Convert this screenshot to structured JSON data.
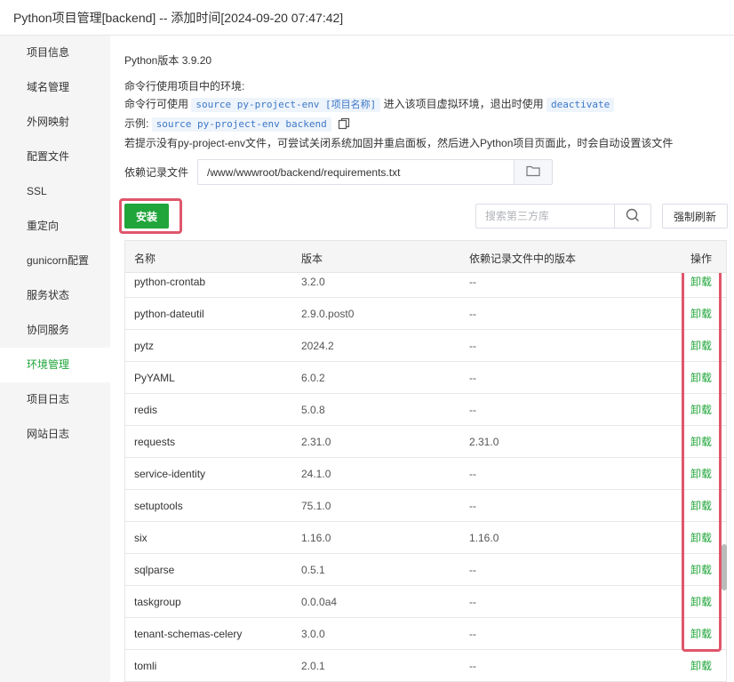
{
  "window": {
    "title": "Python项目管理[backend] -- 添加时间[2024-09-20 07:47:42]"
  },
  "sidebar": {
    "items": [
      {
        "label": "项目信息"
      },
      {
        "label": "域名管理"
      },
      {
        "label": "外网映射"
      },
      {
        "label": "配置文件"
      },
      {
        "label": "SSL"
      },
      {
        "label": "重定向"
      },
      {
        "label": "gunicorn配置"
      },
      {
        "label": "服务状态"
      },
      {
        "label": "协同服务"
      },
      {
        "label": "环境管理"
      },
      {
        "label": "项目日志"
      },
      {
        "label": "网站日志"
      }
    ],
    "active_index": 9
  },
  "env_info": {
    "python_version": "Python版本 3.9.20",
    "cmd_heading": "命令行使用项目中的环境:",
    "cmd_prefix": "命令行可使用",
    "cmd_code": "source py-project-env [项目名称]",
    "cmd_middle": "进入该项目虚拟环境，退出时使用",
    "cmd_deactivate": "deactivate",
    "example_label": "示例:",
    "example_code": "source py-project-env backend",
    "hint": "若提示没有py-project-env文件，可尝试关闭系统加固并重启面板，然后进入Python项目页面此，时会自动设置该文件"
  },
  "requirements": {
    "label": "依赖记录文件",
    "path": "/www/wwwroot/backend/requirements.txt"
  },
  "toolbar": {
    "install_label": "安装",
    "search_placeholder": "搜索第三方库",
    "refresh_label": "强制刷新"
  },
  "table": {
    "headers": {
      "name": "名称",
      "version": "版本",
      "req_version": "依赖记录文件中的版本",
      "action": "操作"
    },
    "rows": [
      {
        "name": "python-crontab",
        "version": "3.2.0",
        "req_version": "--",
        "action": "卸载"
      },
      {
        "name": "python-dateutil",
        "version": "2.9.0.post0",
        "req_version": "--",
        "action": "卸载"
      },
      {
        "name": "pytz",
        "version": "2024.2",
        "req_version": "--",
        "action": "卸载"
      },
      {
        "name": "PyYAML",
        "version": "6.0.2",
        "req_version": "--",
        "action": "卸载"
      },
      {
        "name": "redis",
        "version": "5.0.8",
        "req_version": "--",
        "action": "卸载"
      },
      {
        "name": "requests",
        "version": "2.31.0",
        "req_version": "2.31.0",
        "action": "卸载"
      },
      {
        "name": "service-identity",
        "version": "24.1.0",
        "req_version": "--",
        "action": "卸载"
      },
      {
        "name": "setuptools",
        "version": "75.1.0",
        "req_version": "--",
        "action": "卸载"
      },
      {
        "name": "six",
        "version": "1.16.0",
        "req_version": "1.16.0",
        "action": "卸载"
      },
      {
        "name": "sqlparse",
        "version": "0.5.1",
        "req_version": "--",
        "action": "卸载"
      },
      {
        "name": "taskgroup",
        "version": "0.0.0a4",
        "req_version": "--",
        "action": "卸载"
      },
      {
        "name": "tenant-schemas-celery",
        "version": "3.0.0",
        "req_version": "--",
        "action": "卸载"
      },
      {
        "name": "tomli",
        "version": "2.0.1",
        "req_version": "--",
        "action": "卸载"
      }
    ]
  },
  "colors": {
    "accent": "#20a53a",
    "highlight": "#e0566b"
  }
}
